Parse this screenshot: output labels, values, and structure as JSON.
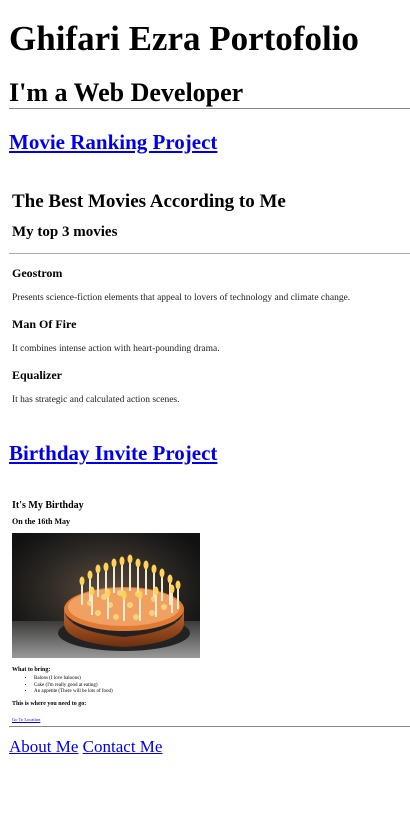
{
  "header": {
    "title": "Ghifari Ezra Portofolio",
    "subtitle": "I'm a Web Developer"
  },
  "projects": {
    "movie_link": "Movie Ranking Project",
    "birthday_link": "Birthday Invite Project"
  },
  "movie_page": {
    "title": "The Best Movies According to Me",
    "subtitle": "My top 3 movies",
    "movies": [
      {
        "name": "Geostrom",
        "desc": "Presents science-fiction elements that appeal to lovers of technology and climate change."
      },
      {
        "name": "Man Of Fire",
        "desc": "It combines intense action with heart-pounding drama."
      },
      {
        "name": "Equalizer",
        "desc": "It has strategic and calculated action scenes."
      }
    ]
  },
  "birthday_page": {
    "title": "It's My Birthday",
    "date": "On the 16th May",
    "bring_heading": "What to bring:",
    "items": [
      "Balons (I love baloons)",
      "Cake (I'm really good at eating)",
      "An appetite (There will be lots of food)"
    ],
    "where_heading": "This is where you need to go:",
    "location_link": "Go To Location"
  },
  "footer": {
    "about": "About Me",
    "contact": "Contact Me"
  }
}
